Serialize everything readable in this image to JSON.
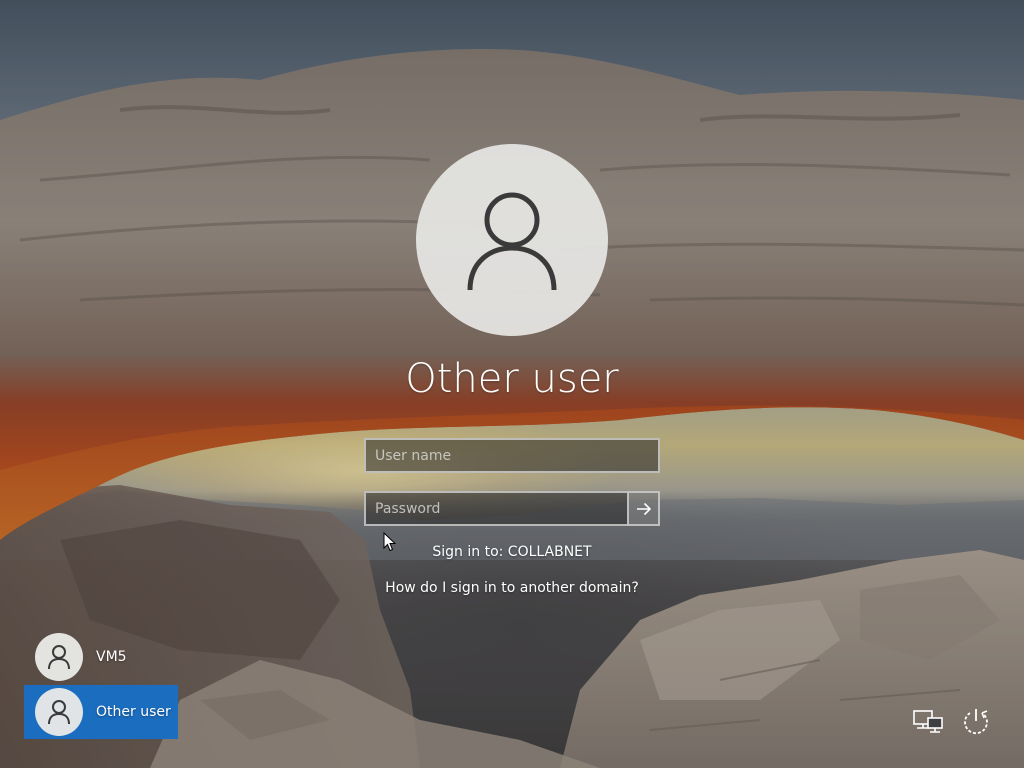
{
  "lockscreen": {
    "user_title": "Other user",
    "username_placeholder": "User name",
    "password_placeholder": "Password",
    "sign_in_to": "Sign in to: COLLABNET",
    "domain_help_link": "How do I sign in to another domain?",
    "submit_icon": "arrow-right-icon",
    "avatar_icon": "user-silhouette-icon"
  },
  "user_switcher": {
    "users": [
      {
        "label": "VM5",
        "selected": false,
        "icon": "user-silhouette-icon"
      },
      {
        "label": "Other user",
        "selected": true,
        "icon": "user-silhouette-icon"
      }
    ],
    "selected_color": "#1a6dbf"
  },
  "system_buttons": {
    "network_icon": "network-icon",
    "power_icon": "power-icon"
  },
  "colors": {
    "text": "#ffffff",
    "field_border": "#cdcdcd",
    "accent": "#1a6dbf"
  }
}
